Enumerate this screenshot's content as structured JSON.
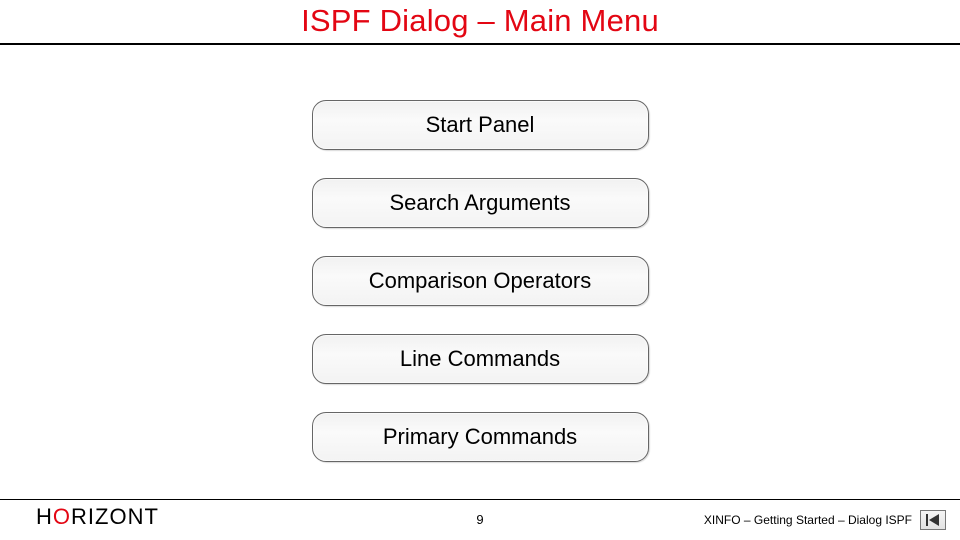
{
  "title": "ISPF Dialog – Main Menu",
  "menu": {
    "items": [
      {
        "label": "Start Panel"
      },
      {
        "label": "Search Arguments"
      },
      {
        "label": "Comparison Operators"
      },
      {
        "label": "Line Commands"
      },
      {
        "label": "Primary Commands"
      }
    ]
  },
  "footer": {
    "brand_pre": "H",
    "brand_accent": "O",
    "brand_post": "RIZONT",
    "page_number": "9",
    "right_text": "XINFO – Getting Started – Dialog ISPF"
  }
}
